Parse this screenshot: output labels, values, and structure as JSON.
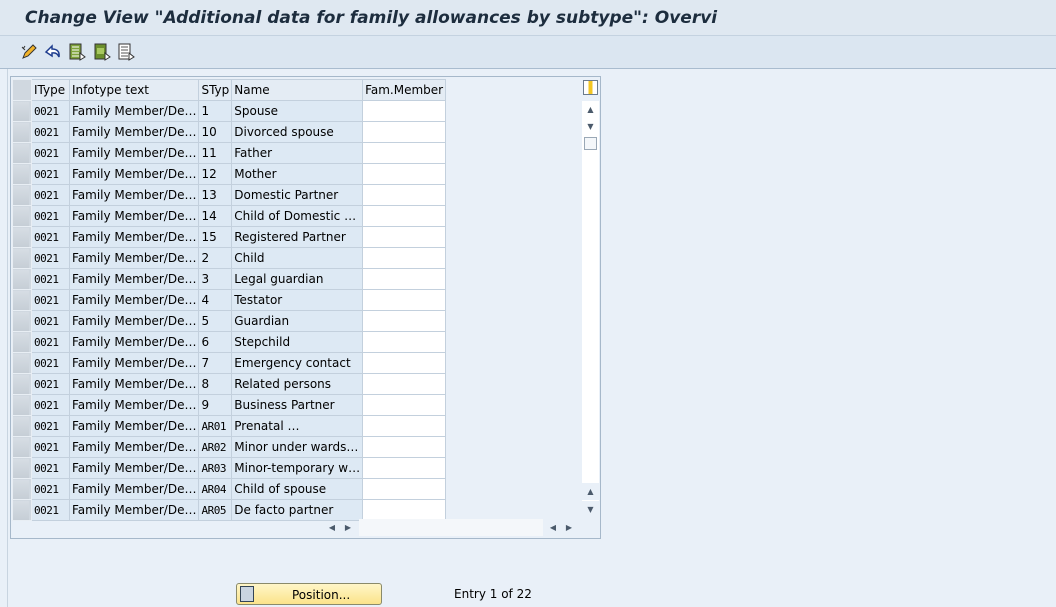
{
  "title": "Change View \"Additional data for family allowances by subtype\": Overvi",
  "toolbar": {
    "icons": [
      "display-change-icon",
      "undo-icon",
      "select-all-icon",
      "select-block-icon",
      "deselect-all-icon"
    ]
  },
  "table": {
    "columns": [
      "IType",
      "Infotype text",
      "STyp",
      "Name",
      "Fam.Member"
    ],
    "rows": [
      [
        "0021",
        "Family Member/De…",
        "1",
        "Spouse",
        ""
      ],
      [
        "0021",
        "Family Member/De…",
        "10",
        "Divorced spouse",
        ""
      ],
      [
        "0021",
        "Family Member/De…",
        "11",
        "Father",
        ""
      ],
      [
        "0021",
        "Family Member/De…",
        "12",
        "Mother",
        ""
      ],
      [
        "0021",
        "Family Member/De…",
        "13",
        "Domestic Partner",
        ""
      ],
      [
        "0021",
        "Family Member/De…",
        "14",
        "Child of Domestic …",
        ""
      ],
      [
        "0021",
        "Family Member/De…",
        "15",
        "Registered Partner",
        ""
      ],
      [
        "0021",
        "Family Member/De…",
        "2",
        "Child",
        ""
      ],
      [
        "0021",
        "Family Member/De…",
        "3",
        "Legal guardian",
        ""
      ],
      [
        "0021",
        "Family Member/De…",
        "4",
        "Testator",
        ""
      ],
      [
        "0021",
        "Family Member/De…",
        "5",
        "Guardian",
        ""
      ],
      [
        "0021",
        "Family Member/De…",
        "6",
        "Stepchild",
        ""
      ],
      [
        "0021",
        "Family Member/De…",
        "7",
        "Emergency contact",
        ""
      ],
      [
        "0021",
        "Family Member/De…",
        "8",
        "Related persons",
        ""
      ],
      [
        "0021",
        "Family Member/De…",
        "9",
        "Business Partner",
        ""
      ],
      [
        "0021",
        "Family Member/De…",
        "AR01",
        "Prenatal                …",
        ""
      ],
      [
        "0021",
        "Family Member/De…",
        "AR02",
        "Minor under wards…",
        ""
      ],
      [
        "0021",
        "Family Member/De…",
        "AR03",
        "Minor-temporary w…",
        ""
      ],
      [
        "0021",
        "Family Member/De…",
        "AR04",
        "Child of spouse",
        ""
      ],
      [
        "0021",
        "Family Member/De…",
        "AR05",
        "De facto partner",
        ""
      ]
    ]
  },
  "footer": {
    "position_label": "Position...",
    "entry_text": "Entry 1 of 22"
  }
}
